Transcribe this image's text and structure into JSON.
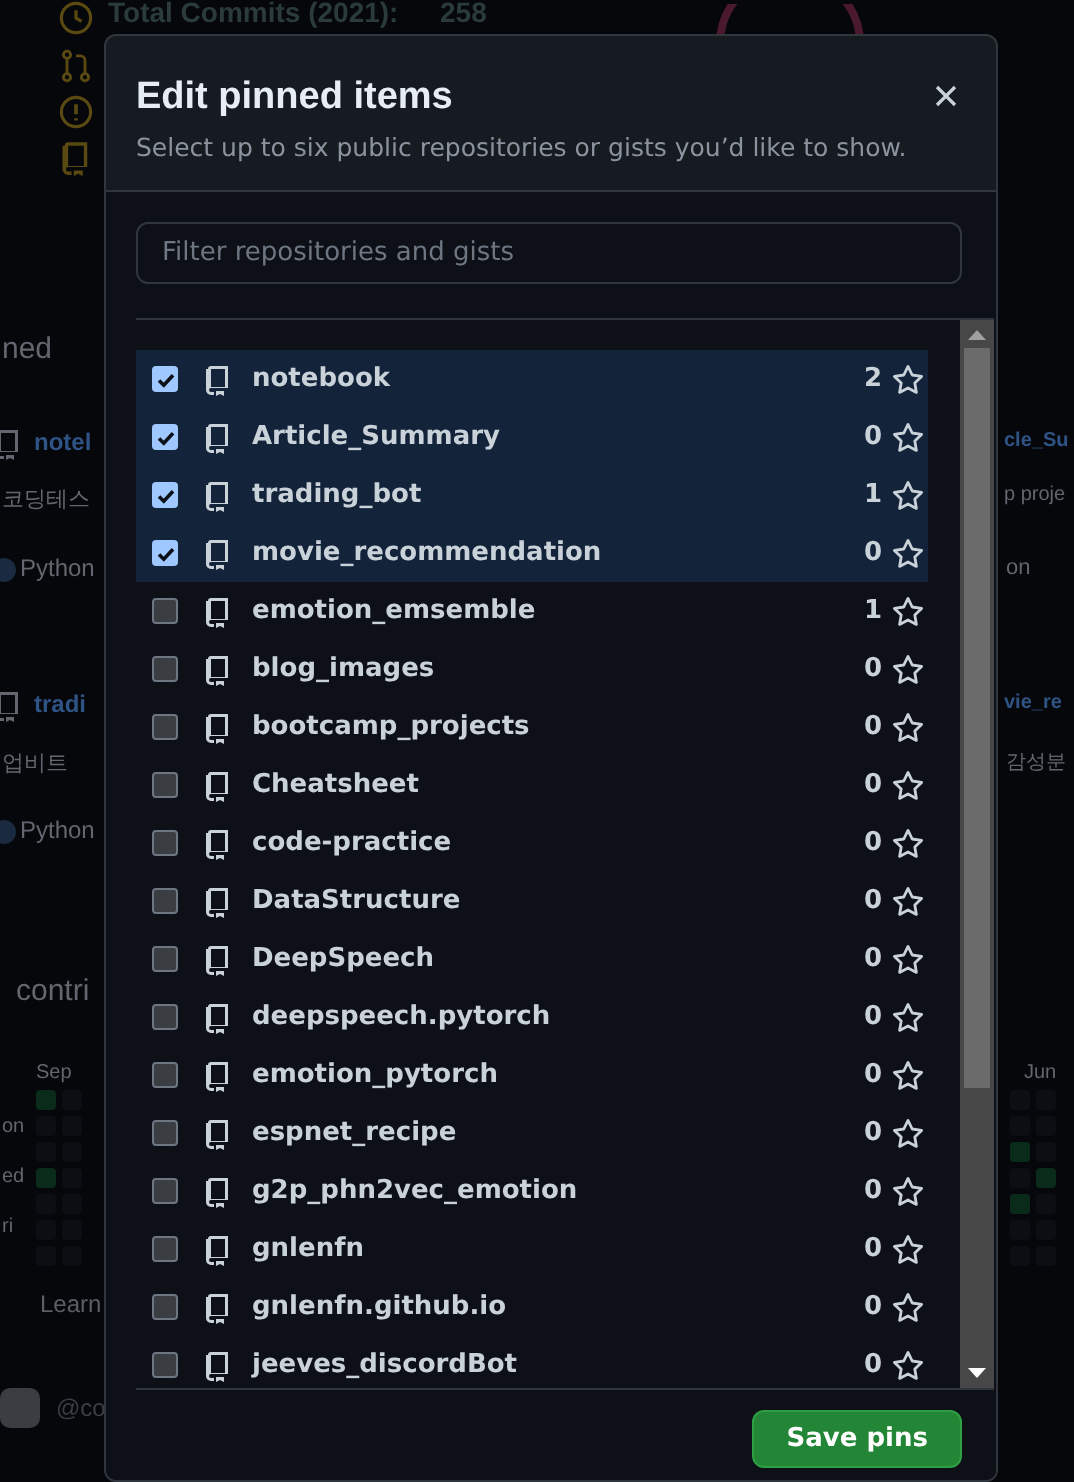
{
  "background": {
    "stats": {
      "label": "Total Commits (2021):",
      "value": "258"
    },
    "pinned_heading": "ned",
    "pinned_cards": [
      {
        "name": "notel",
        "description": "코딩테스",
        "language": "Python"
      },
      {
        "name": "cle_Su",
        "description": "p proje",
        "language": "on"
      },
      {
        "name": "tradi",
        "description": "업비트",
        "language": "Python"
      },
      {
        "name": "vie_re",
        "description": "감성분"
      }
    ],
    "contributions_heading": "contri",
    "months": [
      "Sep",
      "Jun"
    ],
    "weekdays": [
      "on",
      "ed",
      "ri"
    ],
    "learn_link": "Learn",
    "org_handle": "@co"
  },
  "dialog": {
    "title": "Edit pinned items",
    "subtitle": "Select up to six public repositories or gists you’d like to show.",
    "filter": {
      "placeholder": "Filter repositories and gists"
    },
    "repositories": [
      {
        "name": "notebook",
        "stars": "2",
        "checked": true
      },
      {
        "name": "Article_Summary",
        "stars": "0",
        "checked": true
      },
      {
        "name": "trading_bot",
        "stars": "1",
        "checked": true
      },
      {
        "name": "movie_recommendation",
        "stars": "0",
        "checked": true
      },
      {
        "name": "emotion_emsemble",
        "stars": "1",
        "checked": false
      },
      {
        "name": "blog_images",
        "stars": "0",
        "checked": false
      },
      {
        "name": "bootcamp_projects",
        "stars": "0",
        "checked": false
      },
      {
        "name": "Cheatsheet",
        "stars": "0",
        "checked": false
      },
      {
        "name": "code-practice",
        "stars": "0",
        "checked": false
      },
      {
        "name": "DataStructure",
        "stars": "0",
        "checked": false
      },
      {
        "name": "DeepSpeech",
        "stars": "0",
        "checked": false
      },
      {
        "name": "deepspeech.pytorch",
        "stars": "0",
        "checked": false
      },
      {
        "name": "emotion_pytorch",
        "stars": "0",
        "checked": false
      },
      {
        "name": "espnet_recipe",
        "stars": "0",
        "checked": false
      },
      {
        "name": "g2p_phn2vec_emotion",
        "stars": "0",
        "checked": false
      },
      {
        "name": "gnlenfn",
        "stars": "0",
        "checked": false
      },
      {
        "name": "gnlenfn.github.io",
        "stars": "0",
        "checked": false
      },
      {
        "name": "jeeves_discordBot",
        "stars": "0",
        "checked": false
      }
    ],
    "save_button": "Save pins"
  }
}
